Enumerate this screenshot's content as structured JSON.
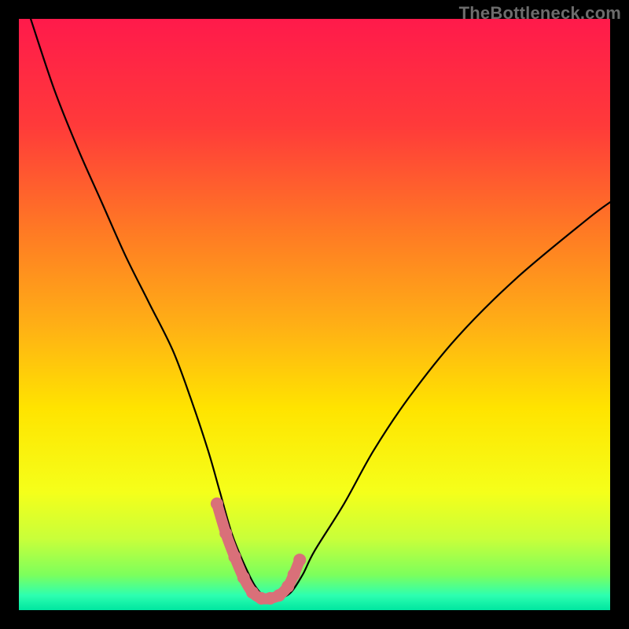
{
  "watermark": "TheBottleneck.com",
  "chart_data": {
    "type": "line",
    "title": "",
    "xlabel": "",
    "ylabel": "",
    "xlim": [
      0,
      100
    ],
    "ylim": [
      0,
      100
    ],
    "series": [
      {
        "name": "bottleneck-curve",
        "x": [
          2,
          6,
          10,
          14,
          18,
          22,
          26,
          29,
          32,
          34,
          36,
          38,
          40,
          42,
          44,
          46,
          48,
          50,
          55,
          60,
          66,
          74,
          84,
          96,
          100
        ],
        "values": [
          100,
          88,
          78,
          69,
          60,
          52,
          44,
          36,
          27,
          20,
          13,
          8,
          4,
          2,
          2,
          3,
          6,
          10,
          18,
          27,
          36,
          46,
          56,
          66,
          69
        ]
      },
      {
        "name": "optimal-highlight",
        "x": [
          33.5,
          35,
          36.5,
          38,
          39.5,
          41,
          42.5,
          44,
          45.5,
          46.5,
          47.5
        ],
        "values": [
          18,
          13,
          9,
          5.5,
          3,
          2,
          2,
          2.5,
          4,
          6,
          8.5
        ]
      }
    ],
    "gradient_stops": [
      {
        "pos": 0.0,
        "color": "#ff1a4b"
      },
      {
        "pos": 0.18,
        "color": "#ff3a3a"
      },
      {
        "pos": 0.36,
        "color": "#ff7a24"
      },
      {
        "pos": 0.52,
        "color": "#ffb015"
      },
      {
        "pos": 0.66,
        "color": "#ffe400"
      },
      {
        "pos": 0.8,
        "color": "#f5ff1a"
      },
      {
        "pos": 0.88,
        "color": "#c8ff3a"
      },
      {
        "pos": 0.94,
        "color": "#7dff5c"
      },
      {
        "pos": 0.975,
        "color": "#2dffb0"
      },
      {
        "pos": 1.0,
        "color": "#00e6a0"
      }
    ],
    "highlight_color": "#d97079",
    "curve_color": "#000000"
  }
}
